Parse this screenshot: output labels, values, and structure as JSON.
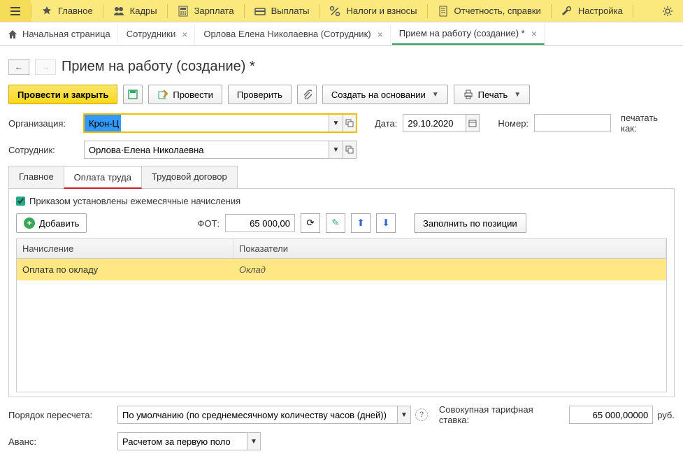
{
  "menubar": {
    "items": [
      {
        "icon": "hamburger",
        "label": ""
      },
      {
        "icon": "star",
        "label": "Главное"
      },
      {
        "icon": "people",
        "label": "Кадры"
      },
      {
        "icon": "calc",
        "label": "Зарплата"
      },
      {
        "icon": "wallet",
        "label": "Выплаты"
      },
      {
        "icon": "percent",
        "label": "Налоги и взносы"
      },
      {
        "icon": "doc",
        "label": "Отчетность, справки"
      },
      {
        "icon": "wrench",
        "label": "Настройка"
      },
      {
        "icon": "gear",
        "label": ""
      }
    ]
  },
  "crumbs": [
    {
      "label": "Начальная страница",
      "closable": false,
      "icon": "home"
    },
    {
      "label": "Сотрудники",
      "closable": true
    },
    {
      "label": "Орлова Елена Николаевна (Сотрудник)",
      "closable": true
    },
    {
      "label": "Прием на работу (создание) *",
      "closable": true,
      "active": true
    }
  ],
  "title": "Прием на работу (создание) *",
  "toolbar": {
    "post_close": "Провести и закрыть",
    "post": "Провести",
    "check": "Проверить",
    "create_based": "Создать на основании",
    "print": "Печать"
  },
  "form": {
    "org_label": "Организация:",
    "org_value": "Крон-Ц",
    "date_label": "Дата:",
    "date_value": "29.10.2020",
    "number_label": "Номер:",
    "number_value": "",
    "print_as": "печатать как:",
    "employee_label": "Сотрудник:",
    "employee_value": "Орлова·Елена Николаевна"
  },
  "subtabs": [
    "Главное",
    "Оплата труда",
    "Трудовой договор"
  ],
  "subtab_active": 1,
  "pay_panel": {
    "checkbox_label": "Приказом установлены ежемесячные начисления",
    "checkbox_checked": true,
    "add_label": "Добавить",
    "fot_label": "ФОТ:",
    "fot_value": "65 000,00",
    "fill_by_pos": "Заполнить по позиции",
    "grid_headers": [
      "Начисление",
      "Показатели"
    ],
    "grid_rows": [
      {
        "accrual": "Оплата по окладу",
        "indicators": "Оклад"
      }
    ]
  },
  "bottom": {
    "recalc_label": "Порядок пересчета:",
    "recalc_value": "По умолчанию (по среднемесячному количеству часов (дней))",
    "rate_label": "Совокупная тарифная ставка:",
    "rate_value": "65 000,00000",
    "rate_unit": "руб.",
    "advance_label": "Аванс:",
    "advance_value": "Расчетом за первую поло"
  }
}
